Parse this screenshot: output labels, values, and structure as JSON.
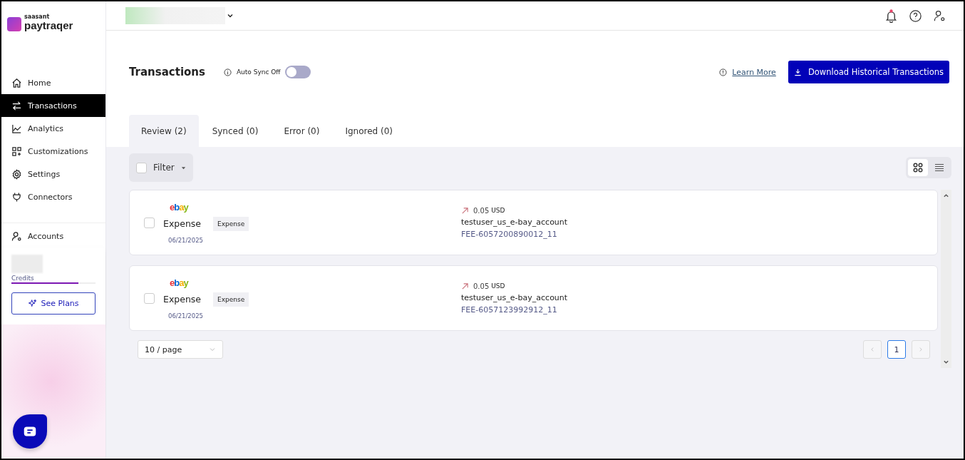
{
  "brand": {
    "company": "saasant",
    "product": "paytraqer"
  },
  "topbar": {
    "notifications_unread": true
  },
  "nav": [
    {
      "label": "Home",
      "kind": "home",
      "selected": false
    },
    {
      "label": "Transactions",
      "kind": "transfer",
      "selected": true
    },
    {
      "label": "Analytics",
      "kind": "chart",
      "selected": false
    },
    {
      "label": "Customizations",
      "kind": "grid",
      "selected": false
    },
    {
      "label": "Settings",
      "kind": "gear",
      "selected": false
    },
    {
      "label": "Connectors",
      "kind": "plug",
      "selected": false
    }
  ],
  "accounts": {
    "label": "Accounts"
  },
  "credits": {
    "label": "Credits",
    "level": 0.8
  },
  "see_plans": "See Plans",
  "page": {
    "title": "Transactions",
    "auto_sync": {
      "label": "Auto Sync Off",
      "on": false
    },
    "learn_more": "Learn More",
    "download_button": "Download Historical Transactions"
  },
  "tabs": [
    {
      "label": "Review (2)",
      "selected": true
    },
    {
      "label": "Synced (0)",
      "selected": false
    },
    {
      "label": "Error (0)",
      "selected": false
    },
    {
      "label": "Ignored (0)",
      "selected": false
    }
  ],
  "filter": {
    "label": "Filter",
    "checked": false
  },
  "view_toggle": [
    {
      "kind": "grid",
      "selected": true
    },
    {
      "kind": "list",
      "selected": false
    }
  ],
  "transactions": [
    {
      "source": "ebay",
      "type": "Expense",
      "tag": "Expense",
      "date": "06/21/2025",
      "amount": "0.05",
      "currency": "USD",
      "account": "testuser_us_e-bay_account",
      "reference": "FEE-6057200890012_11",
      "checked": false
    },
    {
      "source": "ebay",
      "type": "Expense",
      "tag": "Expense",
      "date": "06/21/2025",
      "amount": "0.05",
      "currency": "USD",
      "account": "testuser_us_e-bay_account",
      "reference": "FEE-6057123992912_11",
      "checked": false
    }
  ],
  "pagination": {
    "page_size": "10 / page",
    "pages": [
      {
        "label": "1",
        "selected": true
      }
    ]
  }
}
